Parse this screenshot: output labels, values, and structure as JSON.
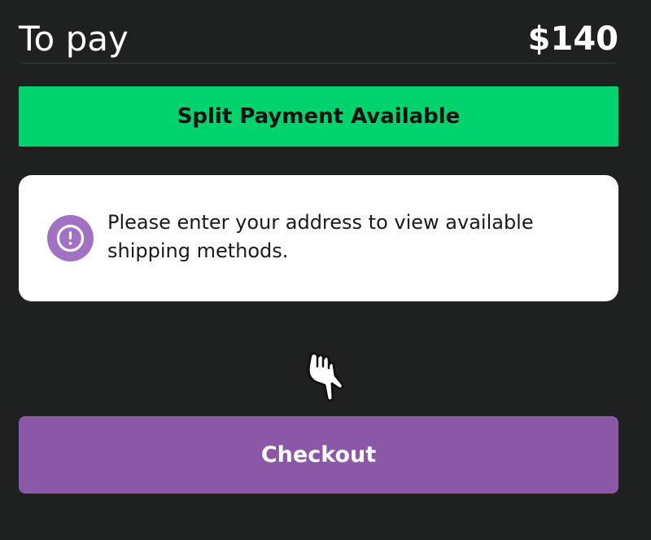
{
  "summary": {
    "label": "To pay",
    "amount": "$140"
  },
  "split_payment": {
    "label": "Split Payment Available"
  },
  "notice": {
    "icon": "exclamation-circle-icon",
    "text": "Please enter your address to view available shipping methods."
  },
  "pointer": {
    "icon": "hand-pointing-down-icon"
  },
  "checkout": {
    "label": "Checkout"
  },
  "colors": {
    "background": "#1f2020",
    "split_banner": "#00d26d",
    "checkout_button": "#8b58a8",
    "notice_icon": "#a171c3"
  }
}
